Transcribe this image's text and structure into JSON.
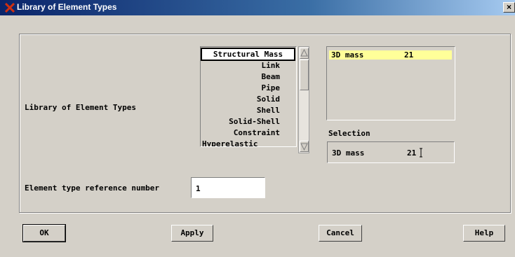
{
  "window": {
    "title": "Library of Element Types",
    "close_label": "×"
  },
  "form": {
    "library_label": "Library of Element Types",
    "ref_label": "Element type reference number",
    "ref_value": "1",
    "selection_label": "Selection"
  },
  "categories": [
    "Structural Mass",
    "Link",
    "Beam",
    "Pipe",
    "Solid",
    "Shell",
    "Solid-Shell",
    "Constraint",
    "Hyperelastic"
  ],
  "types": [
    {
      "name": "3D mass",
      "number": "21"
    }
  ],
  "selection": {
    "name": "3D mass",
    "number": "21"
  },
  "buttons": {
    "ok": "OK",
    "apply": "Apply",
    "cancel": "Cancel",
    "help": "Help"
  },
  "colors": {
    "highlight": "#ffff99",
    "title_bar": "#0a246a"
  }
}
